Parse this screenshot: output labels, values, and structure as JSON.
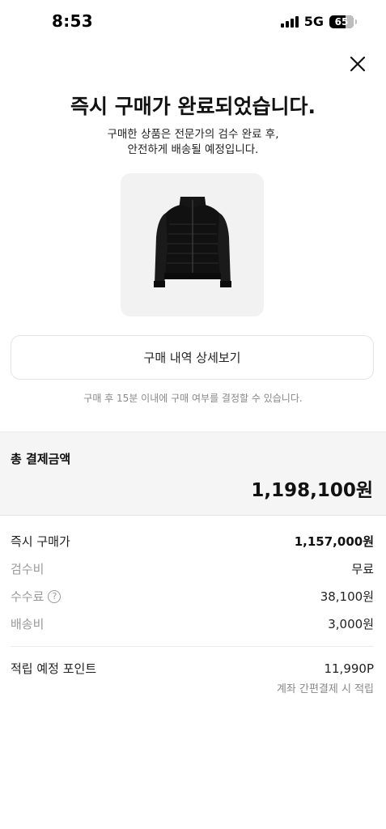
{
  "status_bar": {
    "time": "8:53",
    "network": "5G",
    "battery": "65",
    "battery_level_percent": 65
  },
  "header": {
    "close_icon": "close-icon"
  },
  "confirmation": {
    "title": "즉시 구매가 완료되었습니다.",
    "subtitle_line1": "구매한 상품은 전문가의 검수 완료 후,",
    "subtitle_line2": "안전하게 배송될 예정입니다."
  },
  "product": {
    "image_icon": "jacket-image"
  },
  "actions": {
    "detail_button_label": "구매 내역 상세보기",
    "notice": "구매 후 15분 이내에 구매 여부를 결정할 수 있습니다."
  },
  "total": {
    "label": "총 결제금액",
    "amount": "1,198,100원"
  },
  "breakdown": {
    "instant_price_label": "즉시 구매가",
    "instant_price_value": "1,157,000원",
    "inspection_label": "검수비",
    "inspection_value": "무료",
    "fee_label": "수수료",
    "fee_help": "?",
    "fee_value": "38,100원",
    "shipping_label": "배송비",
    "shipping_value": "3,000원",
    "points_label": "적립 예정 포인트",
    "points_value": "11,990P",
    "points_note": "계좌 간편결제 시 적립"
  }
}
